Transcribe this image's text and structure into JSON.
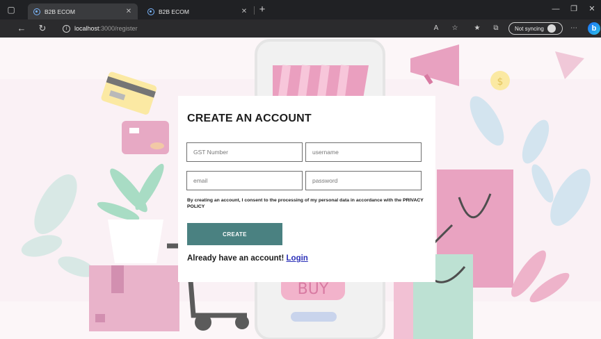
{
  "browser": {
    "tabs": [
      {
        "title": "B2B ECOM",
        "active": true
      },
      {
        "title": "B2B ECOM",
        "active": false
      }
    ],
    "url": {
      "host": "localhost",
      "path": ":3000/register"
    },
    "sync_label": "Not syncing"
  },
  "form": {
    "title": "CREATE AN ACCOUNT",
    "fields": {
      "gst": {
        "placeholder": "GST Number"
      },
      "username": {
        "placeholder": "username"
      },
      "email": {
        "placeholder": "email"
      },
      "password": {
        "placeholder": "password"
      }
    },
    "agreement_text": "By creating an account, I consent to the processing of my personal data in accordance with the",
    "agreement_link": "PRIVACY POLICY",
    "create_label": "CREATE",
    "login_prompt": "Already have an account!",
    "login_link": "Login"
  },
  "background": {
    "buy_label": "BUY",
    "coin_label": "$"
  },
  "colors": {
    "accent": "#4a8181",
    "pink": "#e7a9c4",
    "mint": "#b9dfd2",
    "link": "#2a2fb8"
  }
}
